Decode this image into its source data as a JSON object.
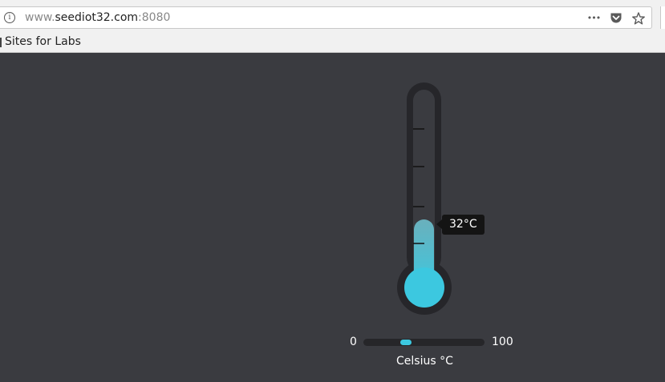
{
  "browser": {
    "url_scheme_prefix": "www.",
    "url_host": "seediot32.com",
    "url_port": ":8080",
    "info_glyph": "i",
    "page_actions": [
      "more-icon",
      "pocket-icon",
      "star-icon"
    ],
    "more_glyph": "•••",
    "star_glyph": "☆"
  },
  "bookmarks": {
    "items": [
      {
        "label": "Sites for Labs",
        "icon": "folder-icon"
      }
    ]
  },
  "thermometer": {
    "value": 32,
    "value_label": "32°C",
    "min": 0,
    "max": 100,
    "tick_count": 4,
    "colors": {
      "background": "#3a3b40",
      "tube": "#26262a",
      "liquid": "#3cc8e0",
      "liquid_top": "#6ab0bc",
      "tick": "#111111"
    }
  },
  "slider": {
    "min_label": "0",
    "max_label": "100",
    "value": 32,
    "accent": "#3cc8e0"
  },
  "unit_label": "Celsius °C"
}
